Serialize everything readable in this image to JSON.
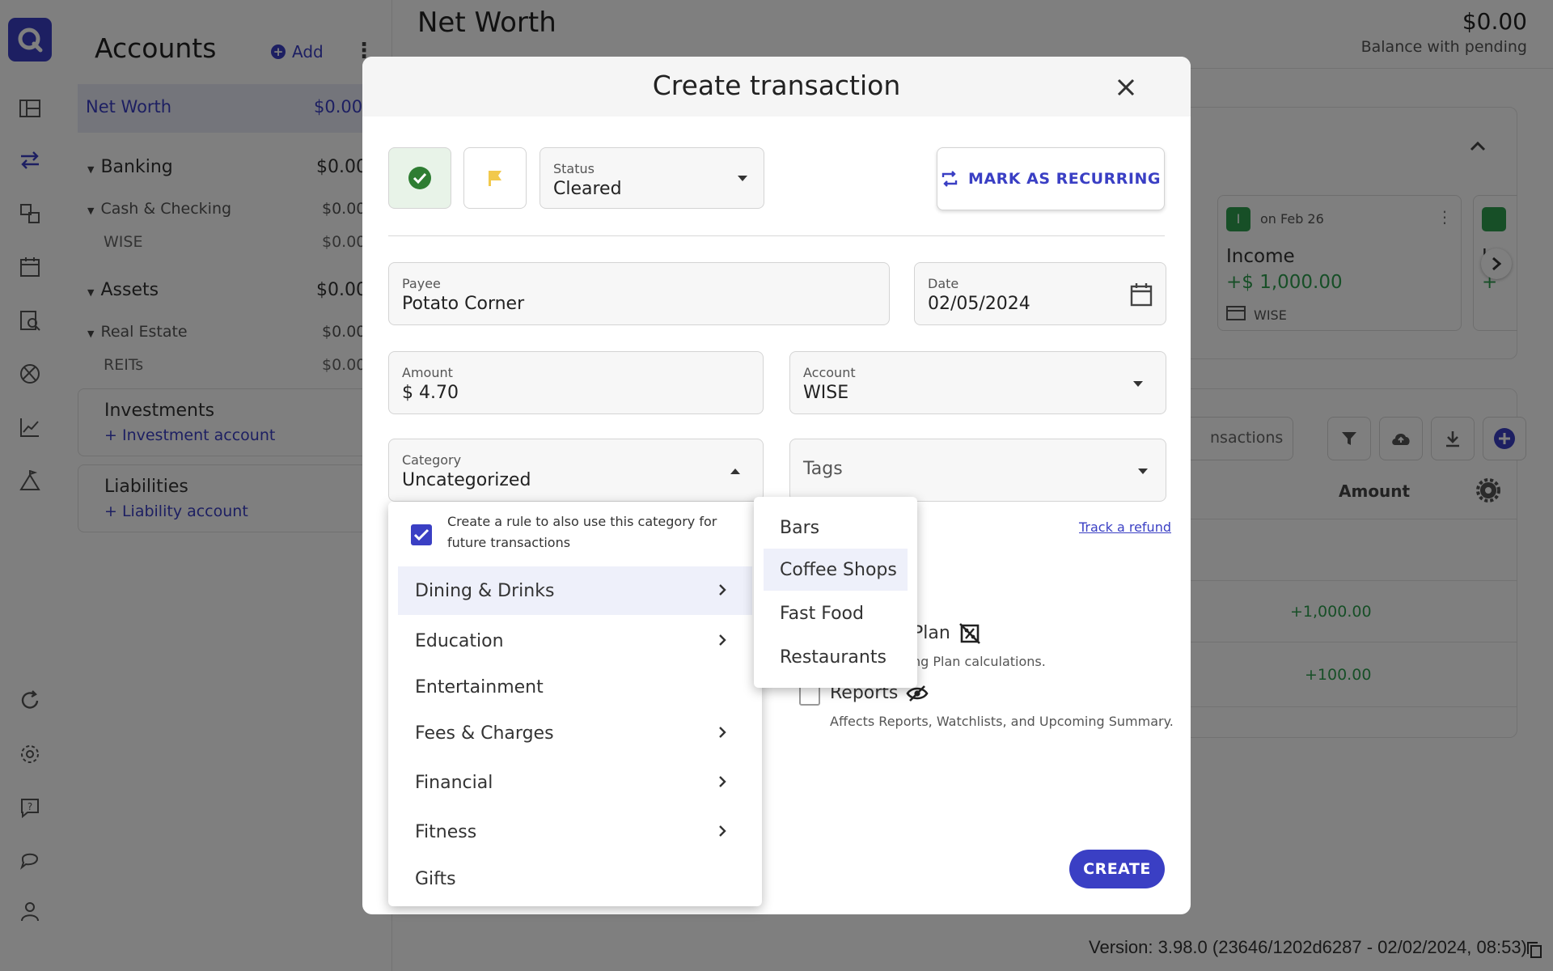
{
  "accounts": {
    "title": "Accounts",
    "add_label": "Add",
    "net_worth": {
      "label": "Net Worth",
      "amount": "$0.00"
    },
    "groups": [
      {
        "label": "Banking",
        "amount": "$0.00"
      },
      {
        "label": "Cash & Checking",
        "amount": "$0.00"
      },
      {
        "label": "WISE",
        "amount": "$0.00"
      },
      {
        "label": "Assets",
        "amount": "$0.00"
      },
      {
        "label": "Real Estate",
        "amount": "$0.00"
      },
      {
        "label": "REITs",
        "amount": "$0.00"
      }
    ],
    "investments": {
      "title": "Investments",
      "link": "+ Investment account"
    },
    "liabilities": {
      "title": "Liabilities",
      "link": "+ Liability account"
    }
  },
  "main": {
    "title": "Net Worth",
    "balance_amount": "$0.00",
    "balance_label": "Balance with pending",
    "upcoming_card": {
      "badge": "I",
      "date": "on Feb 26",
      "title": "Income",
      "amount": "+$ 1,000.00",
      "account": "WISE"
    },
    "upcoming_card_partial": {
      "title": "In",
      "amount": "+"
    },
    "search_placeholder_partial": "nsactions",
    "amount_header": "Amount",
    "rows": [
      {
        "amount": "+1,000.00"
      },
      {
        "amount": "+100.00"
      }
    ],
    "version": "Version: 3.98.0 (23646/1202d6287 - 02/02/2024, 08:53)"
  },
  "modal": {
    "title": "Create transaction",
    "status": {
      "label": "Status",
      "value": "Cleared"
    },
    "recurring_label": "MARK AS RECURRING",
    "payee": {
      "label": "Payee",
      "value": "Potato Corner"
    },
    "date": {
      "label": "Date",
      "value": "02/05/2024"
    },
    "amount": {
      "label": "Amount",
      "value": "$ 4.70"
    },
    "account": {
      "label": "Account",
      "value": "WISE"
    },
    "category": {
      "label": "Category",
      "value": "Uncategorized"
    },
    "tags": {
      "placeholder": "Tags"
    },
    "track_refund": "Track a refund",
    "plan": {
      "label_partial": "Plan",
      "desc_partial": "ng Plan calculations."
    },
    "reports": {
      "label": "Reports",
      "desc": "Affects Reports, Watchlists, and Upcoming Summary."
    },
    "create_label": "CREATE"
  },
  "category_menu": {
    "rule_text": "Create a rule to also use this category for future transactions",
    "rule_checked": true,
    "items": [
      {
        "label": "Dining & Drinks",
        "has_children": true
      },
      {
        "label": "Education",
        "has_children": true
      },
      {
        "label": "Entertainment",
        "has_children": false
      },
      {
        "label": "Fees & Charges",
        "has_children": true
      },
      {
        "label": "Financial",
        "has_children": true
      },
      {
        "label": "Fitness",
        "has_children": true
      },
      {
        "label": "Gifts",
        "has_children": false
      }
    ],
    "submenu": [
      "Bars",
      "Coffee Shops",
      "Fast Food",
      "Restaurants"
    ],
    "submenu_selected": "Coffee Shops"
  },
  "colors": {
    "accent": "#3a3fc4",
    "cleared_green": "#2e7d32",
    "flag_yellow": "#f2c94c",
    "overlay": "rgba(0,0,0,0.5)"
  }
}
